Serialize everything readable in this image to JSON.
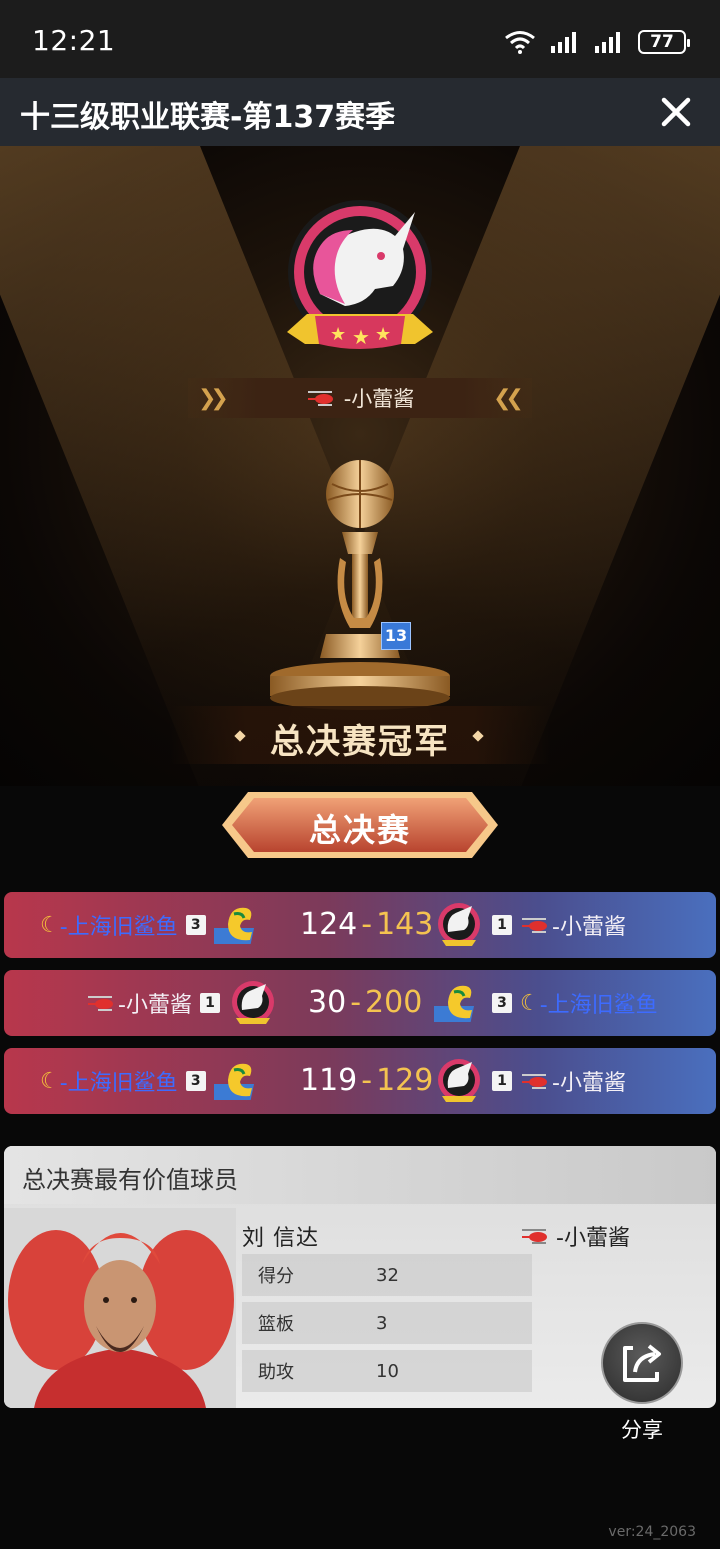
{
  "status_bar": {
    "time": "12:21",
    "battery": "77"
  },
  "header": {
    "title": "十三级职业联赛-第137赛季"
  },
  "champion": {
    "team_name": "-小蕾酱",
    "level_badge": "13",
    "title": "总决赛冠军"
  },
  "finals_label": "总决赛",
  "games": [
    {
      "left_team": "-上海旧鲨鱼",
      "left_seed": "3",
      "score_left": "124",
      "score_right": "143",
      "right_seed": "1",
      "right_team": "-小蕾酱"
    },
    {
      "left_team": "-小蕾酱",
      "left_seed": "1",
      "score_left": "30",
      "score_right": "200",
      "right_seed": "3",
      "right_team": "-上海旧鲨鱼"
    },
    {
      "left_team": "-上海旧鲨鱼",
      "left_seed": "3",
      "score_left": "119",
      "score_right": "129",
      "right_seed": "1",
      "right_team": "-小蕾酱"
    }
  ],
  "mvp": {
    "title": "总决赛最有价值球员",
    "player_name": "刘 信达",
    "team": "-小蕾酱",
    "stats": [
      {
        "label": "得分",
        "value": "32"
      },
      {
        "label": "篮板",
        "value": "3"
      },
      {
        "label": "助攻",
        "value": "10"
      }
    ]
  },
  "share_label": "分享",
  "version": "ver:24_2063",
  "colors": {
    "accent_gold": "#f4c350",
    "team_blue": "#3d6bff",
    "header_bg": "#262a30"
  }
}
